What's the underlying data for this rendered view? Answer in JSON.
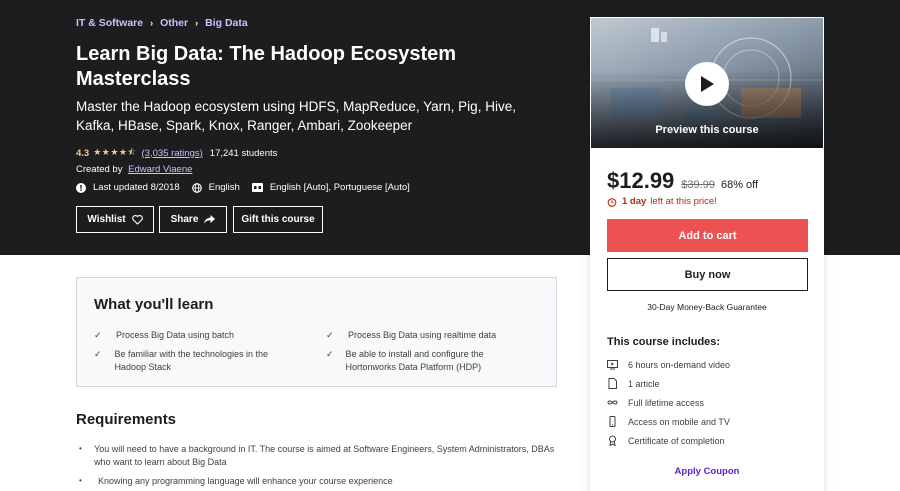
{
  "breadcrumb": [
    "IT & Software",
    "Other",
    "Big Data"
  ],
  "course": {
    "title": "Learn Big Data: The Hadoop Ecosystem Masterclass",
    "subtitle": "Master the Hadoop ecosystem using HDFS, MapReduce, Yarn, Pig, Hive, Kafka, HBase, Spark, Knox, Ranger, Ambari, Zookeeper",
    "rating": "4.3",
    "rating_stars": 4.3,
    "ratings_count": "(3,035 ratings)",
    "students": "17,241 students",
    "created_by_label": "Created by",
    "author": "Edward Viaene",
    "last_updated": "Last updated 8/2018",
    "language": "English",
    "captions": "English [Auto], Portuguese [Auto]"
  },
  "actions": {
    "wishlist": "Wishlist",
    "share": "Share",
    "gift": "Gift this course"
  },
  "sidebar": {
    "preview_label": "Preview this course",
    "price": "$12.99",
    "original_price": "$39.99",
    "discount": "68% off",
    "timer_bold": "1 day",
    "timer_rest": "left at this price!",
    "add_to_cart": "Add to cart",
    "buy_now": "Buy now",
    "guarantee": "30-Day Money-Back Guarantee",
    "includes_title": "This course includes:",
    "includes": [
      {
        "icon": "video-icon",
        "label": "6 hours on-demand video"
      },
      {
        "icon": "article-icon",
        "label": "1 article"
      },
      {
        "icon": "infinity-icon",
        "label": "Full lifetime access"
      },
      {
        "icon": "mobile-icon",
        "label": "Access on mobile and TV"
      },
      {
        "icon": "certificate-icon",
        "label": "Certificate of completion"
      }
    ],
    "apply_coupon": "Apply Coupon"
  },
  "learn": {
    "title": "What you'll learn",
    "items": [
      "Process Big Data using batch",
      "Process Big Data using realtime data",
      "Be familiar with the technologies in the Hadoop Stack",
      "Be able to install and configure the Hortonworks Data Platform (HDP)"
    ]
  },
  "requirements": {
    "title": "Requirements",
    "items": [
      "You will need to have a background in IT. The course is aimed at Software Engineers, System Administrators, DBAs who want to learn about Big Data",
      "Knowing any programming language will enhance your course experience"
    ]
  },
  "colors": {
    "hero_bg": "#1c1d1f",
    "accent_purple": "#cec0fc",
    "star": "#f3ca8c",
    "cart_red": "#ec5252",
    "coupon_purple": "#5624d0",
    "timer_red": "#b32d0f"
  }
}
